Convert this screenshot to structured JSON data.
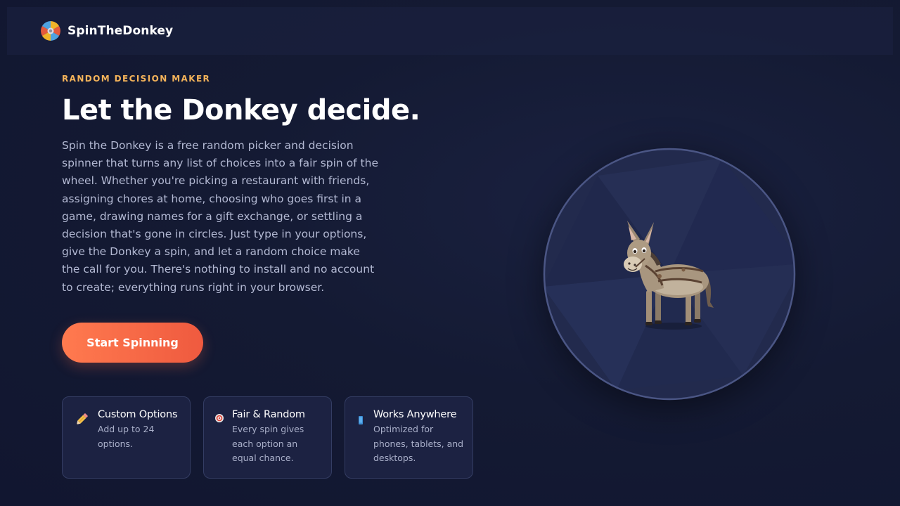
{
  "nav": {
    "brand_name": "SpinTheDonkey"
  },
  "hero": {
    "eyebrow": "RANDOM DECISION MAKER",
    "headline": "Let the Donkey decide.",
    "description": "Spin the Donkey is a free random picker and decision spinner that turns any list of choices into a fair spin of the wheel. Whether you're picking a restaurant with friends, assigning chores at home, choosing who goes first in a game, drawing names for a gift exchange, or settling a decision that's gone in circles. Just type in your options, give the Donkey a spin, and let a random choice make the call for you. There's nothing to install and no account to create; everything runs right in your browser.",
    "cta_label": "Start Spinning"
  },
  "features": [
    {
      "icon": "pencil-icon",
      "title": "Custom Options",
      "text": "Add up to 24 options."
    },
    {
      "icon": "target-icon",
      "title": "Fair & Random",
      "text": "Every spin gives each option an equal chance."
    },
    {
      "icon": "phone-icon",
      "title": "Works Anywhere",
      "text": "Optimized for phones, tablets, and desktops."
    }
  ],
  "colors": {
    "accent": "#ff7a4f",
    "eyebrow": "#f4b35a",
    "background": "#141a33",
    "card": "#1c2242"
  }
}
